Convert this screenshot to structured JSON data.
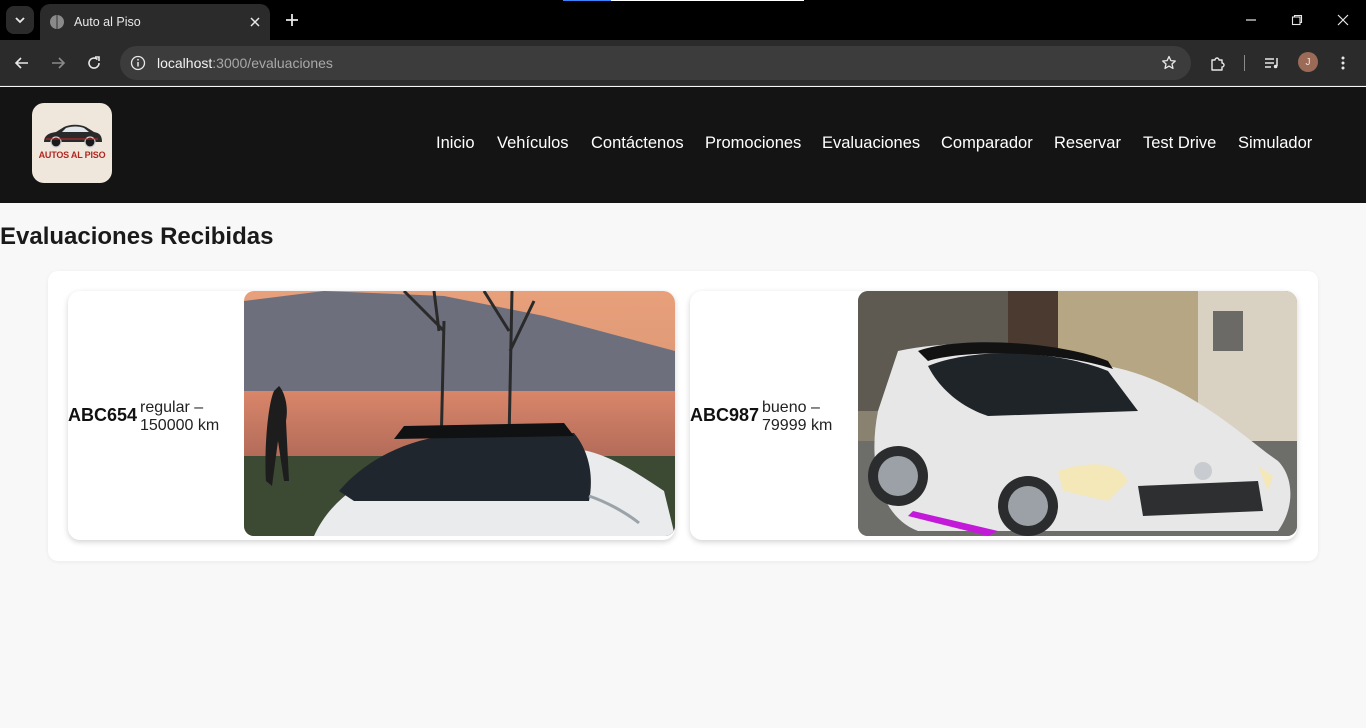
{
  "browser": {
    "tab_title": "Auto al Piso",
    "url_host": "localhost",
    "url_path": ":3000/evaluaciones",
    "profile_initial": "J"
  },
  "site": {
    "logo_text": "AUTOS AL PISO",
    "nav": [
      "Inicio",
      "Vehículos",
      "Contáctenos",
      "Promociones",
      "Evaluaciones",
      "Comparador",
      "Reservar",
      "Test Drive",
      "Simulador"
    ]
  },
  "page": {
    "title": "Evaluaciones Recibidas",
    "evaluations": [
      {
        "plate": "ABC654",
        "condition_line": "regular –",
        "km_line": "150000 km",
        "image": "white-sedan-lakeside-photo"
      },
      {
        "plate": "ABC987",
        "condition_line": "bueno –",
        "km_line": "79999 km",
        "image": "white-hatchback-street-photo"
      }
    ]
  },
  "colors": {
    "header_bg": "#141414",
    "page_bg": "#f8f8f8",
    "logo_red": "#b3261e"
  }
}
